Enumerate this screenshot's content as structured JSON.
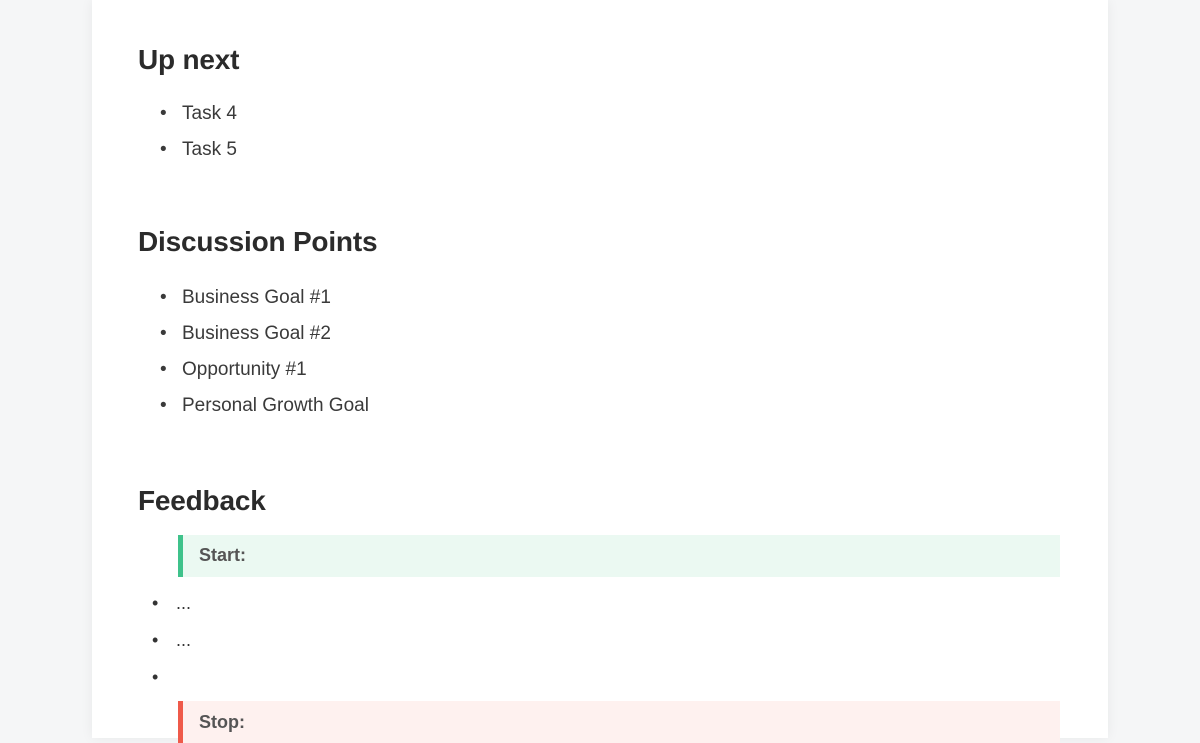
{
  "sections": {
    "up_next": {
      "heading": "Up next",
      "items": [
        "Task 4",
        "Task 5"
      ]
    },
    "discussion": {
      "heading": "Discussion Points",
      "items": [
        "Business Goal #1",
        "Business Goal #2",
        "Opportunity #1",
        "Personal Growth Goal"
      ]
    },
    "feedback": {
      "heading": "Feedback",
      "start_label": "Start:",
      "start_items": [
        "...",
        "...",
        ""
      ],
      "stop_label": "Stop:"
    }
  },
  "colors": {
    "start_accent": "#3fc28b",
    "start_bg": "#ebf9f2",
    "stop_accent": "#ef5a4a",
    "stop_bg": "#fef1ef"
  }
}
